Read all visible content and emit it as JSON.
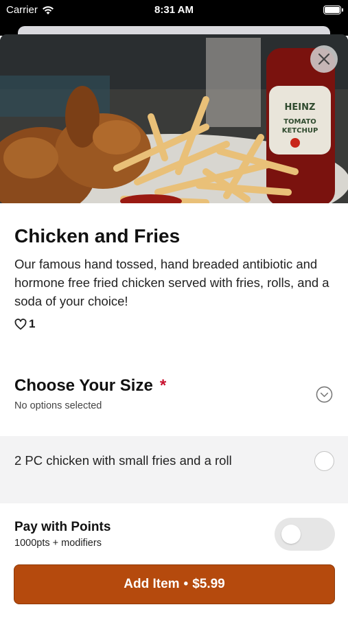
{
  "status_bar": {
    "carrier": "Carrier",
    "time": "8:31 AM"
  },
  "item": {
    "title": "Chicken and Fries",
    "description": "Our famous hand tossed, hand breaded antibiotic and hormone free fried chicken served with fries, rolls, and a soda of your choice!",
    "likes": "1",
    "hero_image": "fried chicken and fries with ketchup bottle"
  },
  "size_section": {
    "title": "Choose Your Size",
    "required_marker": "*",
    "subtitle": "No options selected",
    "options": [
      {
        "label": "2 PC chicken with small fries and a roll",
        "selected": false
      }
    ]
  },
  "points": {
    "title": "Pay with Points",
    "subtitle": "1000pts + modifiers",
    "enabled": false
  },
  "cta": {
    "label": "Add Item",
    "separator": "•",
    "price": "$5.99"
  },
  "colors": {
    "accent": "#b54a0d",
    "required": "#c8102e"
  }
}
